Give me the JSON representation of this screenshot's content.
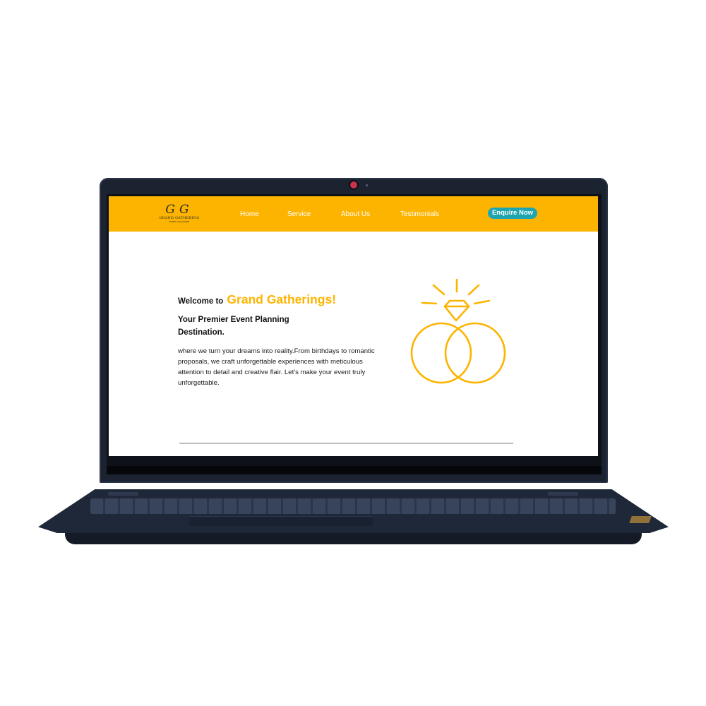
{
  "brand": {
    "logo_mark": "GG",
    "logo_name": "GRAND GATHERING",
    "logo_tagline": "EVENT ORGANISER"
  },
  "navbar": {
    "items": [
      {
        "label": "Home"
      },
      {
        "label": "Service"
      },
      {
        "label": "About Us"
      },
      {
        "label": "Testimonials"
      }
    ],
    "cta_label": "Enquire Now"
  },
  "hero": {
    "welcome_prefix": "Welcome to",
    "brand_name": "Grand Gatherings!",
    "tagline": "Your Premier Event Planning Destination.",
    "description": "where we turn your dreams into reality.From birthdays to romantic proposals, we craft unforgettable experiences with meticulous attention to detail and creative flair. Let's make your event truly unforgettable."
  },
  "icons": {
    "hero_illustration": "wedding-rings-icon",
    "webcam": "webcam-icon"
  },
  "colors": {
    "brand_yellow": "#fdb400",
    "cta_teal": "#1fa5b0",
    "laptop_body": "#1f2839"
  }
}
